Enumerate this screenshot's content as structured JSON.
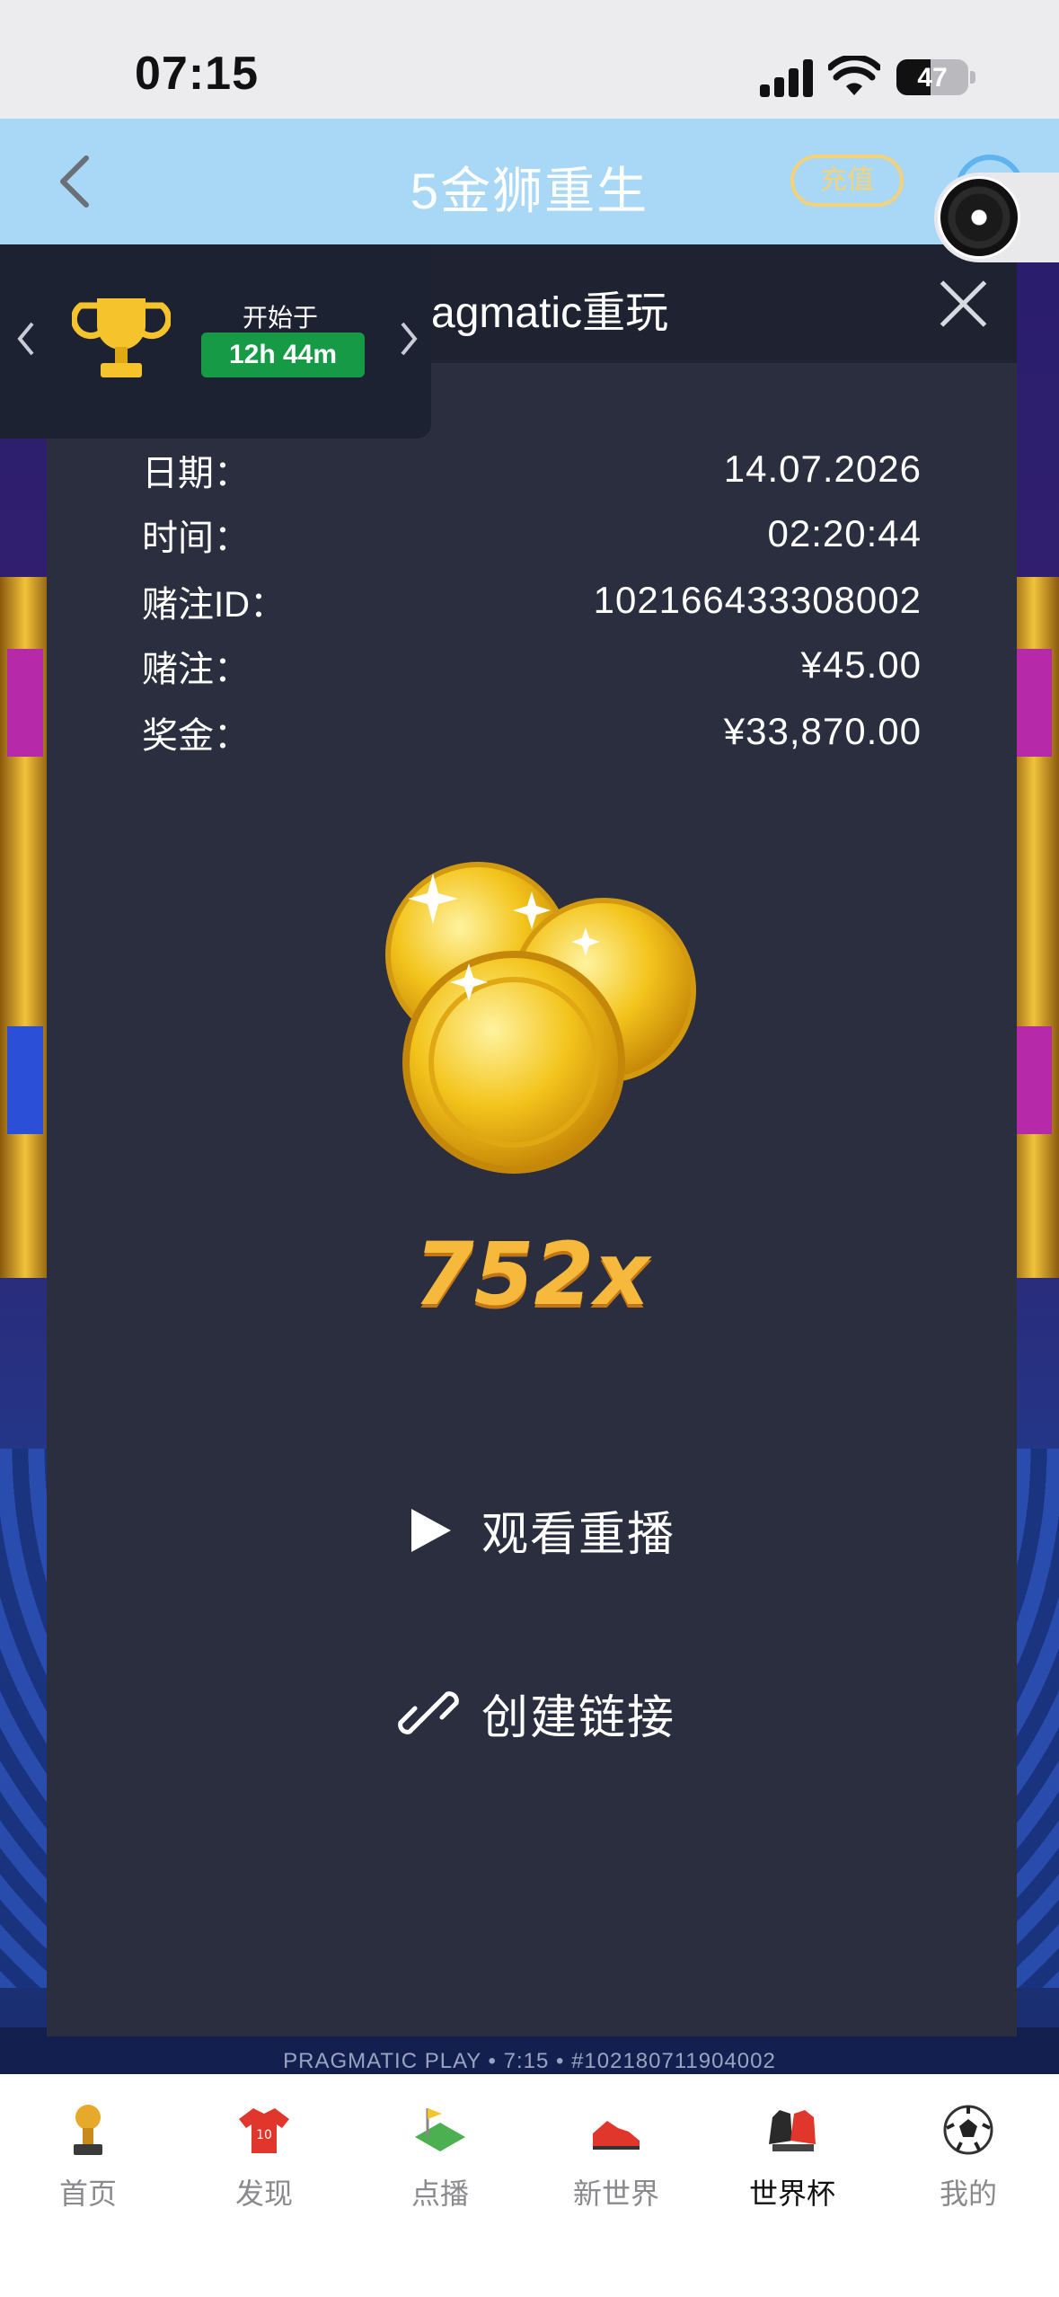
{
  "status_bar": {
    "time": "07:15",
    "battery": "47",
    "battery_level": 0.47
  },
  "header": {
    "title": "5金狮重生",
    "recharge_label": "充值"
  },
  "tournament": {
    "starts_label": "开始于",
    "countdown": "12h 44m"
  },
  "modal": {
    "title": "Pragmatic重玩",
    "rows": [
      {
        "label": "日期：",
        "value": "14.07.2026"
      },
      {
        "label": "时间：",
        "value": "02:20:44"
      },
      {
        "label": "赌注ID：",
        "value": "102166433308002"
      },
      {
        "label": "赌注：",
        "value": "¥45.00"
      },
      {
        "label": "奖金：",
        "value": "¥33,870.00"
      }
    ],
    "multiplier": "752x",
    "watch_replay_label": "观看重播",
    "create_link_label": "创建链接"
  },
  "game_footer": "PRAGMATIC PLAY • 7:15 • #102180711904002",
  "tabbar": {
    "active": "世界杯",
    "items": [
      {
        "label": "首页",
        "icon": "trophy-icon"
      },
      {
        "label": "发现",
        "icon": "jersey-icon"
      },
      {
        "label": "点播",
        "icon": "pitch-icon"
      },
      {
        "label": "新世界",
        "icon": "boots-icon"
      },
      {
        "label": "世界杯",
        "icon": "gloves-icon"
      },
      {
        "label": "我的",
        "icon": "soccer-ball-icon"
      }
    ]
  },
  "colors": {
    "header_bg": "#a9d8f7",
    "modal_bg": "#2b2e3f",
    "countdown_bg": "#169a45",
    "multiplier": "#f6b93b",
    "recharge_border": "#f4d27a"
  }
}
